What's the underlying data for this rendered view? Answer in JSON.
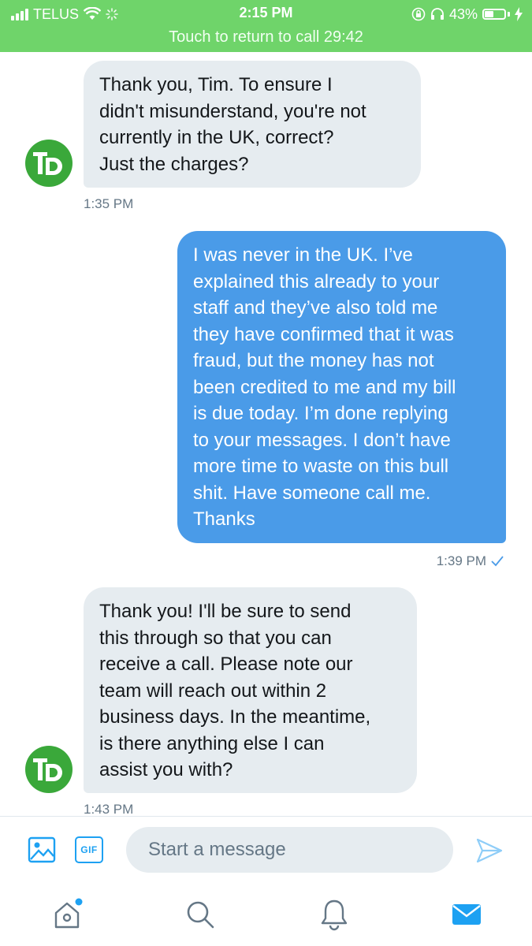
{
  "status": {
    "carrier": "TELUS",
    "time": "2:15 PM",
    "battery": "43%",
    "battery_level": 0.43,
    "call_banner": "Touch to return to call 29:42"
  },
  "messages": [
    {
      "direction": "incoming",
      "lines": [
        "Thank you, Tim. To ensure I",
        "didn't misunderstand, you're not",
        "currently in the UK, correct?",
        "Just the charges?"
      ],
      "time": "1:35 PM"
    },
    {
      "direction": "outgoing",
      "lines": [
        "I was never in the UK. I’ve",
        "explained this already to your",
        "staff and they’ve also told me",
        "they have confirmed that it was",
        "fraud, but the money has not",
        "been credited to me and my bill",
        "is due today. I’m done replying",
        "to your messages. I don’t have",
        "more time to waste on this bull",
        "shit. Have someone call me.",
        "Thanks"
      ],
      "time": "1:39 PM"
    },
    {
      "direction": "incoming",
      "lines": [
        "Thank you! I'll be sure to send",
        "this through so that you can",
        "receive a call. Please note our",
        "team will reach out within 2",
        "business days. In the meantime,",
        "is there anything else I can",
        "assist you with?"
      ],
      "time": "1:43 PM"
    }
  ],
  "avatar": {
    "label": "TD",
    "color": "#3aa83a"
  },
  "composer": {
    "placeholder": "Start a message",
    "gif_label": "GIF"
  },
  "icons": [
    "image-icon",
    "gif-icon",
    "send-icon",
    "home-icon",
    "search-icon",
    "notifications-icon",
    "messages-icon"
  ],
  "colors": {
    "status_bar": "#6fd46a",
    "outgoing_bubble": "#4a9be8",
    "incoming_bubble": "#e6ecf0",
    "accent": "#1da1f2"
  }
}
